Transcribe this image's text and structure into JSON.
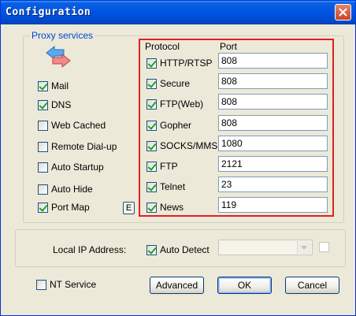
{
  "window": {
    "title": "Configuration"
  },
  "proxy_group": {
    "title": "Proxy services"
  },
  "services": [
    {
      "label": "Mail",
      "checked": true
    },
    {
      "label": "DNS",
      "checked": true
    },
    {
      "label": "Web Cached",
      "checked": false
    },
    {
      "label": "Remote Dial-up",
      "checked": false
    },
    {
      "label": "Auto Startup",
      "checked": false
    },
    {
      "label": "Auto Hide",
      "checked": false
    },
    {
      "label": "Port Map",
      "checked": true
    }
  ],
  "port_map_edit_label": "E",
  "protocol_table": {
    "protocol_header": "Protocol",
    "port_header": "Port",
    "rows": [
      {
        "protocol": "HTTP/RTSP",
        "checked": true,
        "port": "808"
      },
      {
        "protocol": "Secure",
        "checked": true,
        "port": "808"
      },
      {
        "protocol": "FTP(Web)",
        "checked": true,
        "port": "808"
      },
      {
        "protocol": "Gopher",
        "checked": true,
        "port": "808"
      },
      {
        "protocol": "SOCKS/MMS",
        "checked": true,
        "port": "1080"
      },
      {
        "protocol": "FTP",
        "checked": true,
        "port": "2121"
      },
      {
        "protocol": "Telnet",
        "checked": true,
        "port": "23"
      },
      {
        "protocol": "News",
        "checked": true,
        "port": "119"
      }
    ]
  },
  "local_ip": {
    "label": "Local IP Address:",
    "auto_detect_label": "Auto Detect",
    "auto_detect_checked": true,
    "address_value": ""
  },
  "nt_service": {
    "label": "NT Service",
    "checked": false
  },
  "buttons": {
    "advanced": "Advanced",
    "ok": "OK",
    "cancel": "Cancel"
  },
  "colors": {
    "title_bar": "#0054e3",
    "dialog_bg": "#ece9d8",
    "group_title": "#0046d5",
    "highlight_border": "#dd2222",
    "check_mark": "#21a121"
  },
  "icons": {
    "proxy": "bidirectional-arrows-icon",
    "close": "close-icon"
  }
}
